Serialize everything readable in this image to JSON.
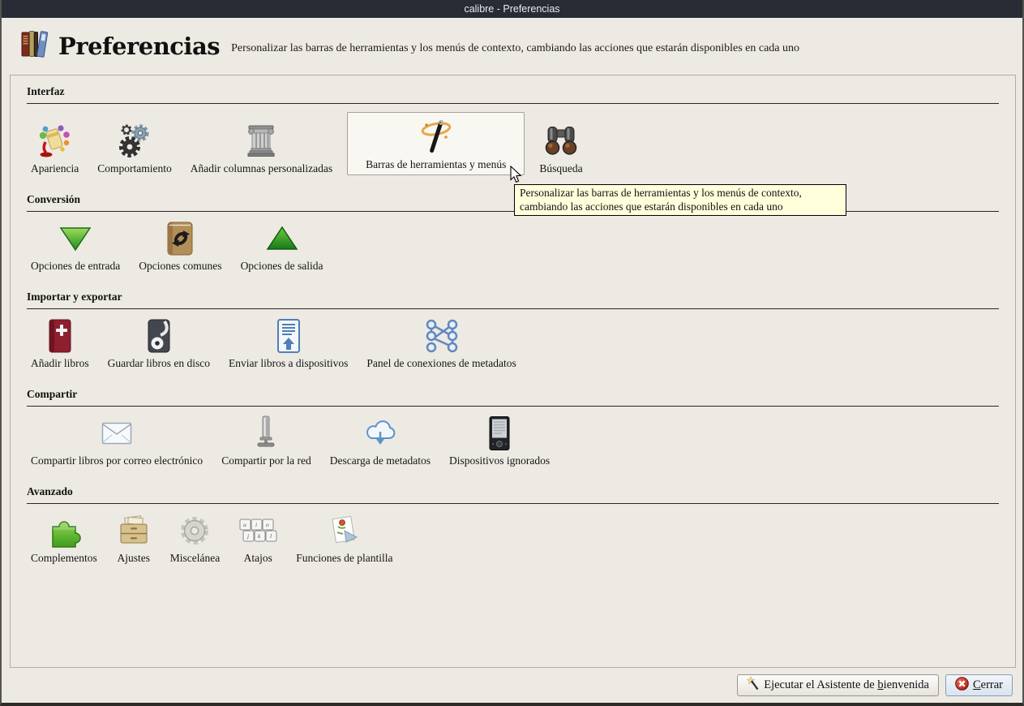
{
  "window": {
    "title": "calibre - Preferencias"
  },
  "header": {
    "title": "Preferencias",
    "subtitle": "Personalizar las barras de herramientas y los menús de contexto, cambiando las acciones que estarán disponibles en cada uno",
    "logo_icon": "calibre-books-icon"
  },
  "sections": [
    {
      "title": "Interfaz",
      "items": [
        {
          "label": "Apariencia",
          "icon": "appearance-icon"
        },
        {
          "label": "Comportamiento",
          "icon": "behavior-icon"
        },
        {
          "label": "Añadir columnas personalizadas",
          "icon": "add-columns-icon"
        },
        {
          "label": "Barras de herramientas y menús",
          "icon": "toolbars-menus-icon",
          "selected": true
        },
        {
          "label": "Búsqueda",
          "icon": "search-icon"
        }
      ]
    },
    {
      "title": "Conversión",
      "items": [
        {
          "label": "Opciones de entrada",
          "icon": "input-options-icon"
        },
        {
          "label": "Opciones comunes",
          "icon": "common-options-icon"
        },
        {
          "label": "Opciones de salida",
          "icon": "output-options-icon"
        }
      ]
    },
    {
      "title": "Importar y exportar",
      "items": [
        {
          "label": "Añadir libros",
          "icon": "add-books-icon"
        },
        {
          "label": "Guardar libros en disco",
          "icon": "save-to-disk-icon"
        },
        {
          "label": "Enviar libros a dispositivos",
          "icon": "send-to-device-icon"
        },
        {
          "label": "Panel de conexiones de metadatos",
          "icon": "metadata-plugboard-icon"
        }
      ]
    },
    {
      "title": "Compartir",
      "items": [
        {
          "label": "Compartir libros por correo electrónico",
          "icon": "email-share-icon"
        },
        {
          "label": "Compartir por la red",
          "icon": "network-share-icon"
        },
        {
          "label": "Descarga de metadatos",
          "icon": "metadata-download-icon"
        },
        {
          "label": "Dispositivos ignorados",
          "icon": "ignored-devices-icon"
        }
      ]
    },
    {
      "title": "Avanzado",
      "items": [
        {
          "label": "Complementos",
          "icon": "plugins-icon"
        },
        {
          "label": "Ajustes",
          "icon": "tweaks-icon"
        },
        {
          "label": "Miscelánea",
          "icon": "misc-gear-icon"
        },
        {
          "label": "Atajos",
          "icon": "shortcuts-icon"
        },
        {
          "label": "Funciones de plantilla",
          "icon": "template-functions-icon"
        }
      ]
    }
  ],
  "tooltip": {
    "text": "Personalizar las barras de herramientas y los menús de contexto, cambiando las acciones que estarán disponibles en cada uno"
  },
  "footer": {
    "wizard_button": {
      "pre": "Ejecutar el Asistente de ",
      "mnemonic": "b",
      "post": "ienvenida",
      "icon": "wand-icon"
    },
    "close_button": {
      "pre": "",
      "mnemonic": "C",
      "post": "errar",
      "icon": "close-x-icon"
    }
  },
  "colors": {
    "titlebar_bg": "#272c35",
    "window_bg": "#edeae3",
    "tooltip_bg": "#ffffdc",
    "selected_item_bg": "#f9f7f2",
    "close_icon_red": "#b72025",
    "accent_green": "#2f9e2f",
    "accent_blue": "#4f7fb5"
  }
}
